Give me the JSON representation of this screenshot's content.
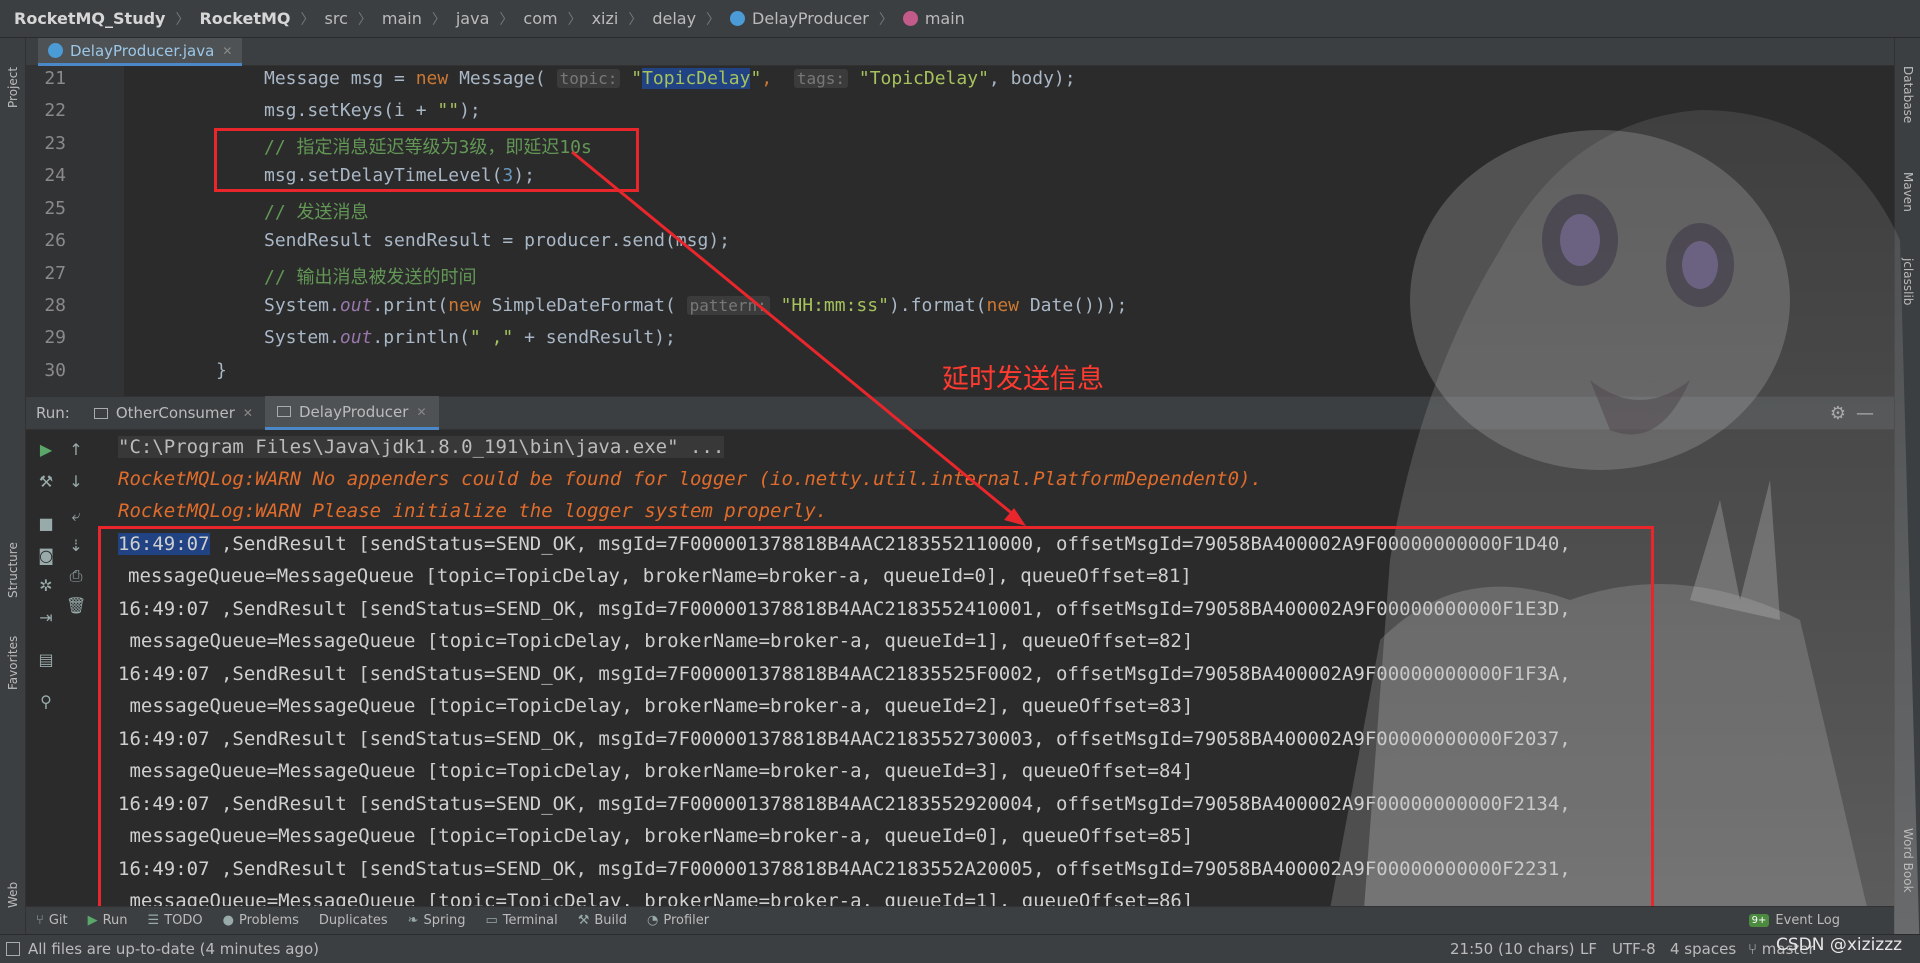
{
  "breadcrumb": {
    "items": [
      "RocketMQ_Study",
      "RocketMQ",
      "src",
      "main",
      "java",
      "com",
      "xizi",
      "delay",
      "DelayProducer",
      "main"
    ]
  },
  "editor_tab": {
    "label": "DelayProducer.java"
  },
  "editor": {
    "line_numbers": [
      "21",
      "22",
      "23",
      "24",
      "25",
      "26",
      "27",
      "28",
      "29",
      "30"
    ],
    "line21": {
      "a": "Message msg = ",
      "kw": "new",
      "b": " Message( ",
      "hint1": "topic:",
      "s1a": "\"",
      "sel": "TopicDelay",
      "s1b": "\"",
      ",": ", ",
      "hint2": "tags:",
      "s2": "\"TopicDelay\"",
      "c": ", body);"
    },
    "line22": {
      "a": "msg.setKeys(i + ",
      "s": "\"\"",
      "b": ");"
    },
    "line23": {
      "cm": "// 指定消息延迟等级为3级，即延迟10s"
    },
    "line24": {
      "a": "msg.setDelayTimeLevel(",
      "n": "3",
      "b": ");"
    },
    "line25": {
      "cm": "// 发送消息"
    },
    "line26": {
      "a": "SendResult sendResult = producer.send(msg);"
    },
    "line27": {
      "cm": "// 输出消息被发送的时间"
    },
    "line28": {
      "a": "System.",
      "f": "out",
      "b": ".print(",
      "kw": "new",
      "c": " SimpleDateFormat( ",
      "hint": "pattern:",
      "s": "\"HH:mm:ss\"",
      "d": ").format(",
      "kw2": "new",
      "e": " Date()));"
    },
    "line29": {
      "a": "System.",
      "f": "out",
      "b": ".println(",
      "s": "\" ,\"",
      "c": " + sendResult);"
    },
    "line30": {
      "a": "}"
    }
  },
  "annotation": {
    "text": "延时发送信息"
  },
  "run": {
    "label": "Run:",
    "tabs": [
      "OtherConsumer",
      "DelayProducer"
    ]
  },
  "console": {
    "cmd": "\"C:\\Program Files\\Java\\jdk1.8.0_191\\bin\\java.exe\" ...",
    "warn1": "RocketMQLog:WARN No appenders could be found for logger (io.netty.util.internal.PlatformDependent0).",
    "warn2": "RocketMQLog:WARN Please initialize the logger system properly.",
    "time0": "16:49:07",
    "rest0": " ,SendResult [sendStatus=SEND_OK, msgId=7F000001378818B4AAC2183552110000, offsetMsgId=79058BA400002A9F00000000000F1D40,",
    "q0": "messageQueue=MessageQueue [topic=TopicDelay, brokerName=broker-a, queueId=0], queueOffset=81]",
    "r1": "16:49:07 ,SendResult [sendStatus=SEND_OK, msgId=7F000001378818B4AAC2183552410001, offsetMsgId=79058BA400002A9F00000000000F1E3D,",
    "q1": " messageQueue=MessageQueue [topic=TopicDelay, brokerName=broker-a, queueId=1], queueOffset=82]",
    "r2": "16:49:07 ,SendResult [sendStatus=SEND_OK, msgId=7F000001378818B4AAC21835525F0002, offsetMsgId=79058BA400002A9F00000000000F1F3A,",
    "q2": " messageQueue=MessageQueue [topic=TopicDelay, brokerName=broker-a, queueId=2], queueOffset=83]",
    "r3": "16:49:07 ,SendResult [sendStatus=SEND_OK, msgId=7F000001378818B4AAC2183552730003, offsetMsgId=79058BA400002A9F00000000000F2037,",
    "q3": " messageQueue=MessageQueue [topic=TopicDelay, brokerName=broker-a, queueId=3], queueOffset=84]",
    "r4": "16:49:07 ,SendResult [sendStatus=SEND_OK, msgId=7F000001378818B4AAC2183552920004, offsetMsgId=79058BA400002A9F00000000000F2134,",
    "q4": " messageQueue=MessageQueue [topic=TopicDelay, brokerName=broker-a, queueId=0], queueOffset=85]",
    "r5": "16:49:07 ,SendResult [sendStatus=SEND_OK, msgId=7F000001378818B4AAC2183552A20005, offsetMsgId=79058BA400002A9F00000000000F2231,",
    "q5": " messageQueue=MessageQueue [topic=TopicDelay, brokerName=broker-a, queueId=1], queueOffset=86]"
  },
  "left_tool": {
    "project": "Project",
    "structure": "Structure",
    "favorites": "Favorites",
    "web": "Web"
  },
  "right_tool": {
    "database": "Database",
    "maven": "Maven",
    "jclasslib": "jclasslib",
    "wordbook": "Word Book"
  },
  "bottom_tools": [
    "Git",
    "Run",
    "TODO",
    "Problems",
    "Duplicates",
    "Spring",
    "Terminal",
    "Build",
    "Profiler"
  ],
  "event_log": {
    "badge": "9+",
    "label": "Event Log"
  },
  "status": {
    "message": "All files are up-to-date (4 minutes ago)",
    "position": "21:50 (10 chars)",
    "line_sep": "LF",
    "encoding": "UTF-8",
    "indent": "4 spaces",
    "branch": "master",
    "watermark": "CSDN @xizizzz"
  },
  "colors": {
    "accent": "#4a88c7",
    "annotation_red": "#e8262c",
    "warn": "#e06c2c",
    "comment": "#629755",
    "keyword": "#cc7832"
  }
}
